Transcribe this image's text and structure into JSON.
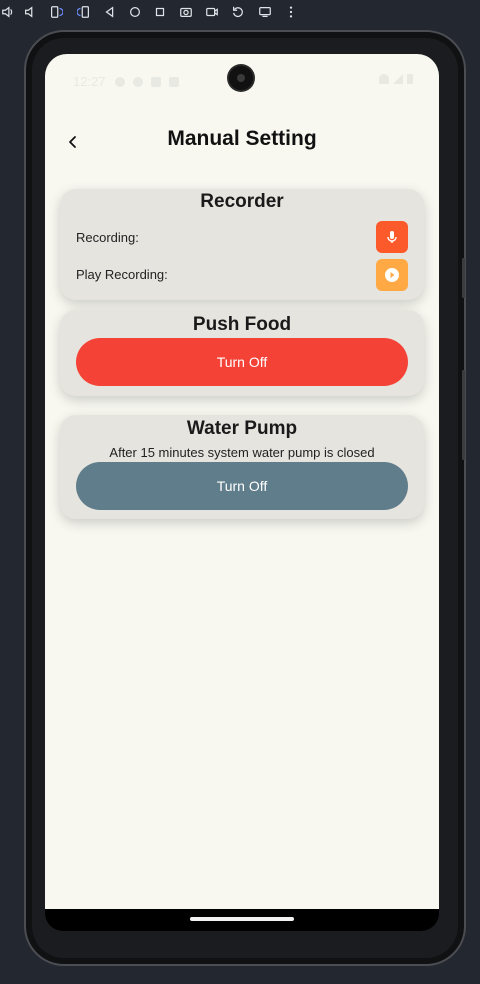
{
  "status_bar": {
    "time": "12:27"
  },
  "header": {
    "title": "Manual Setting",
    "back_icon": "chevron-left-icon"
  },
  "recorder": {
    "title": "Recorder",
    "recording_label": "Recording:",
    "play_label": "Play Recording:",
    "mic_icon": "microphone-icon",
    "play_icon": "play-icon",
    "mic_color": "#fc5a2b",
    "play_color": "#ffa944"
  },
  "push_food": {
    "title": "Push Food",
    "button_label": "Turn Off",
    "button_color": "#f44336"
  },
  "water_pump": {
    "title": "Water Pump",
    "description": "After 15 minutes system water pump is closed",
    "button_label": "Turn Off",
    "button_color": "#607d8b"
  },
  "colors": {
    "screen_bg": "#f8f8f1",
    "card_bg": "#e6e4df"
  }
}
